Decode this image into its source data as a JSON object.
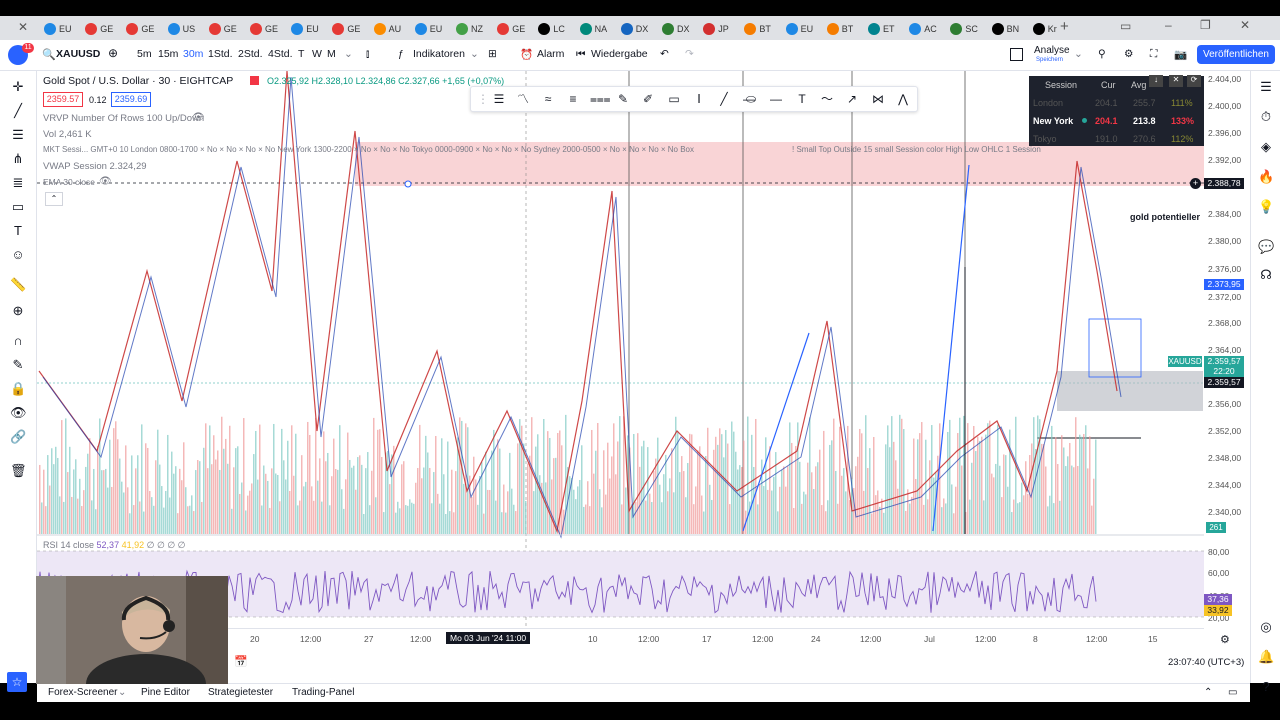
{
  "browser": {
    "tabs": [
      "EU",
      "GE",
      "GE",
      "US",
      "GE",
      "GE",
      "EU",
      "GE",
      "AU",
      "EU",
      "NZ",
      "GE",
      "LC",
      "NA",
      "DX",
      "DX",
      "JP",
      "BT",
      "EU",
      "BT",
      "ET",
      "AC",
      "SC",
      "BN",
      "Kr"
    ],
    "tab_colors": [
      "#1e88e5",
      "#e53935",
      "#e53935",
      "#1e88e5",
      "#e53935",
      "#e53935",
      "#1e88e5",
      "#e53935",
      "#fb8c00",
      "#1e88e5",
      "#43a047",
      "#e53935",
      "#000000",
      "#00897b",
      "#1565c0",
      "#2e7d32",
      "#d32f2f",
      "#f57c00",
      "#1e88e5",
      "#f57c00",
      "#00838f",
      "#1e88e5",
      "#2e7d32",
      "#000000",
      "#000000"
    ]
  },
  "toolbar": {
    "symbol": "XAUUSD",
    "intervals": [
      "5m",
      "15m",
      "30m",
      "1Std.",
      "2Std.",
      "4Std.",
      "T",
      "W",
      "M"
    ],
    "active_interval": "30m",
    "indicators_label": "Indikatoren",
    "alarm_label": "Alarm",
    "replay_label": "Wiedergabe",
    "analysis_label": "Analyse",
    "analysis_sub": "Speichern",
    "publish_label": "Veröffentlichen",
    "avatar_badge": "11"
  },
  "legend": {
    "title": "Gold Spot / U.S. Dollar · 30 · EIGHTCAP",
    "ohlc": "O2.325,92 H2.328,10 L2.324,86 C2.327,66 +1,65 (+0,07%)",
    "sell_price": "2359.57",
    "spread": "0.12",
    "buy_price": "2359.69",
    "vrvp": "VRVP Number Of Rows 100 Up/Down",
    "vol": "Vol  2,461 K",
    "mkt_session": "MKT Sessi... GMT+0 10 London 0800-1700 × No × No × No × No New York 1300-2200 × No × No × No Tokyo 0000-0900 × No × No × No Sydney 2000-0500 × No × No × No × No Box",
    "small_top": "! Small Top Outside 15 small Session color High Low OHLC 1 Session",
    "vwap": "VWAP Session  2.324,29",
    "ema": "EMA 30 close"
  },
  "session_table": {
    "headers": [
      "Session",
      "Cur",
      "Avg"
    ],
    "rows": [
      {
        "name": "London",
        "cur": "204.1",
        "avg": "255.7",
        "pct": "111%"
      },
      {
        "name": "New York",
        "cur": "204.1",
        "avg": "213.8",
        "pct": "133%"
      },
      {
        "name": "Tokyo",
        "cur": "191.0",
        "avg": "270.6",
        "pct": "112%"
      }
    ]
  },
  "price_axis": {
    "labels": [
      "2.404,00",
      "2.400,00",
      "2.396,00",
      "2.392,00",
      "2.388,78",
      "2.384,00",
      "2.380,00",
      "2.376,00",
      "2.373,95",
      "2.372,00",
      "2.368,00",
      "2.364,00",
      "2.359,57",
      "2.356,00",
      "2.352,00",
      "2.348,00",
      "2.344,00",
      "2.340,00"
    ],
    "xauusd_label": "XAUUSD",
    "current_price": "2.359,57",
    "countdown": "22:20",
    "current_price2": "2.359,57",
    "hline_price": "2.388,78",
    "blue_price": "2.373,95",
    "volume_badge": "261"
  },
  "annotation": "gold potentieller",
  "rsi": {
    "legend": "RSI 14 close",
    "value1": "52,37",
    "value2": "41,92",
    "nan": "∅ ∅ ∅ ∅",
    "axis": [
      "80,00",
      "60,00",
      "40,00",
      "20,00"
    ],
    "badge1": "37,36",
    "badge2": "33,92"
  },
  "time_axis": {
    "labels": [
      "12:00",
      "20",
      "12:00",
      "27",
      "12:00",
      "Mo 03 Jun '24   11:00",
      "10",
      "12:00",
      "17",
      "12:00",
      "24",
      "12:00",
      "Jul",
      "12:00",
      "8",
      "12:00",
      "15"
    ],
    "clock": "23:07:40 (UTC+3)"
  },
  "bottom_tabs": [
    "Forex-Screener",
    "Pine Editor",
    "Strategietester",
    "Trading-Panel"
  ]
}
